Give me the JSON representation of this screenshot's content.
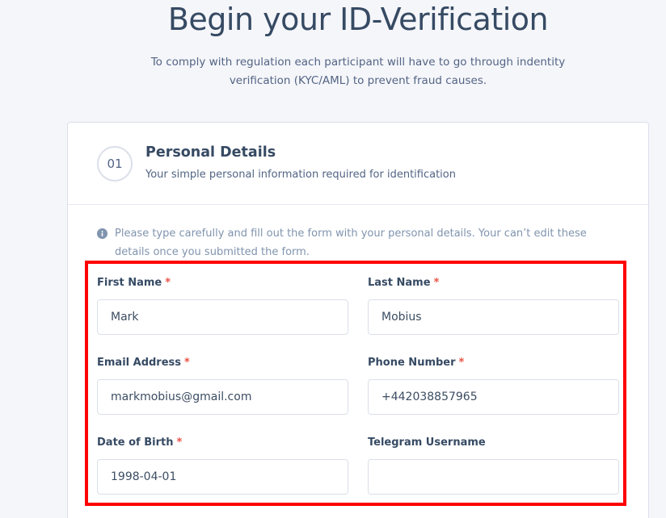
{
  "header": {
    "title": "Begin your ID-Verification",
    "subtitle": "To comply with regulation each participant will have to go through indentity verification (KYC/AML) to prevent fraud causes."
  },
  "card": {
    "step_number": "01",
    "title": "Personal Details",
    "subtitle": "Your simple personal information required for identification",
    "notice": "Please type carefully and fill out the form with your personal details. Your can’t edit these details once you submitted the form."
  },
  "form": {
    "required_mark": "*",
    "first_name": {
      "label": "First Name",
      "value": "Mark"
    },
    "last_name": {
      "label": "Last Name",
      "value": "Mobius"
    },
    "email": {
      "label": "Email Address",
      "value": "markmobius@gmail.com"
    },
    "phone": {
      "label": "Phone Number",
      "value": "+442038857965"
    },
    "dob": {
      "label": "Date of Birth",
      "value": "1998-04-01"
    },
    "telegram": {
      "label": "Telegram Username",
      "value": ""
    }
  },
  "colors": {
    "accent_highlight": "#ff0000",
    "required": "#e85347",
    "text_primary": "#364a63",
    "background": "#f5f6fa"
  },
  "icons": {
    "notice": "info-icon"
  }
}
